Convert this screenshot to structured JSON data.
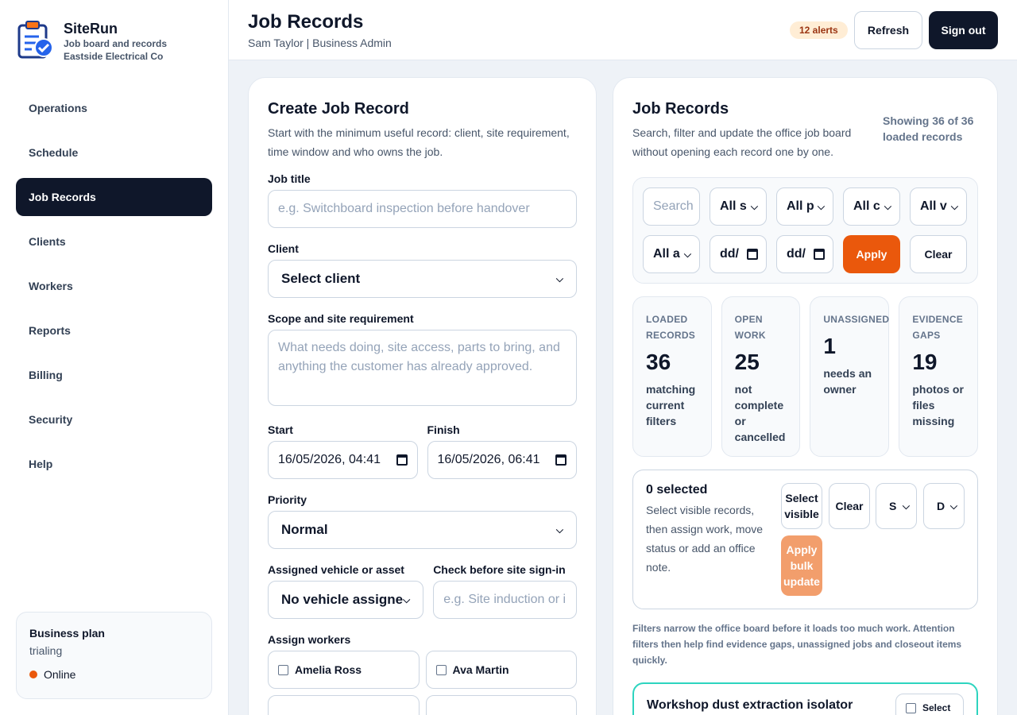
{
  "brand": {
    "name": "SiteRun",
    "tagline": "Job board and records",
    "company": "Eastside Electrical Co"
  },
  "nav": {
    "items": [
      {
        "label": "Operations"
      },
      {
        "label": "Schedule"
      },
      {
        "label": "Job Records",
        "active": true
      },
      {
        "label": "Clients"
      },
      {
        "label": "Workers"
      },
      {
        "label": "Reports"
      },
      {
        "label": "Billing"
      },
      {
        "label": "Security"
      },
      {
        "label": "Help"
      }
    ]
  },
  "plan": {
    "title": "Business plan",
    "status": "trialing",
    "online": "Online"
  },
  "header": {
    "title": "Job Records",
    "user": "Sam Taylor | Business Admin",
    "alerts": "12 alerts",
    "refresh": "Refresh",
    "signout": "Sign out"
  },
  "create": {
    "title": "Create Job Record",
    "desc": "Start with the minimum useful record: client, site requirement, time window and who owns the job.",
    "job_title_label": "Job title",
    "job_title_placeholder": "e.g. Switchboard inspection before handover",
    "client_label": "Client",
    "client_value": "Select client",
    "scope_label": "Scope and site requirement",
    "scope_placeholder": "What needs doing, site access, parts to bring, and anything the customer has already approved.",
    "start_label": "Start",
    "start_value": "16/05/2026, 04:41",
    "finish_label": "Finish",
    "finish_value": "16/05/2026, 06:41",
    "priority_label": "Priority",
    "priority_value": "Normal",
    "vehicle_label": "Assigned vehicle or asset",
    "vehicle_value": "No vehicle assigne",
    "check_label": "Check before site sign-in",
    "check_placeholder": "e.g. Site induction or i",
    "workers_label": "Assign workers",
    "workers": [
      "Amelia Ross",
      "Ava Martin"
    ]
  },
  "records": {
    "title": "Job Records",
    "desc": "Search, filter and update the office job board without opening each record one by one.",
    "count": "Showing 36 of 36 loaded records",
    "filters": {
      "search_placeholder": "Search",
      "f1": "All s",
      "f2": "All p",
      "f3": "All c",
      "f4": "All v",
      "f5": "All a",
      "date_from": "dd/",
      "date_to": "dd/",
      "apply": "Apply",
      "clear": "Clear"
    },
    "stats": [
      {
        "label": "LOADED RECORDS",
        "value": "36",
        "note": "matching current filters"
      },
      {
        "label": "OPEN WORK",
        "value": "25",
        "note": "not complete or cancelled"
      },
      {
        "label": "UNASSIGNED",
        "value": "1",
        "note": "needs an owner"
      },
      {
        "label": "EVIDENCE GAPS",
        "value": "19",
        "note": "photos or files missing"
      }
    ],
    "bulk": {
      "title": "0 selected",
      "desc": "Select visible records, then assign work, move status or add an office note.",
      "select_visible": "Select visible",
      "clear": "Clear",
      "sel1": "S",
      "sel2": "D",
      "apply": "Apply bulk update"
    },
    "hint": "Filters narrow the office board before it loads too much work. Attention filters then help find evidence gaps, unassigned jobs and closeout items quickly.",
    "job": {
      "title": "Workshop dust extraction isolator",
      "select": "Select"
    }
  }
}
